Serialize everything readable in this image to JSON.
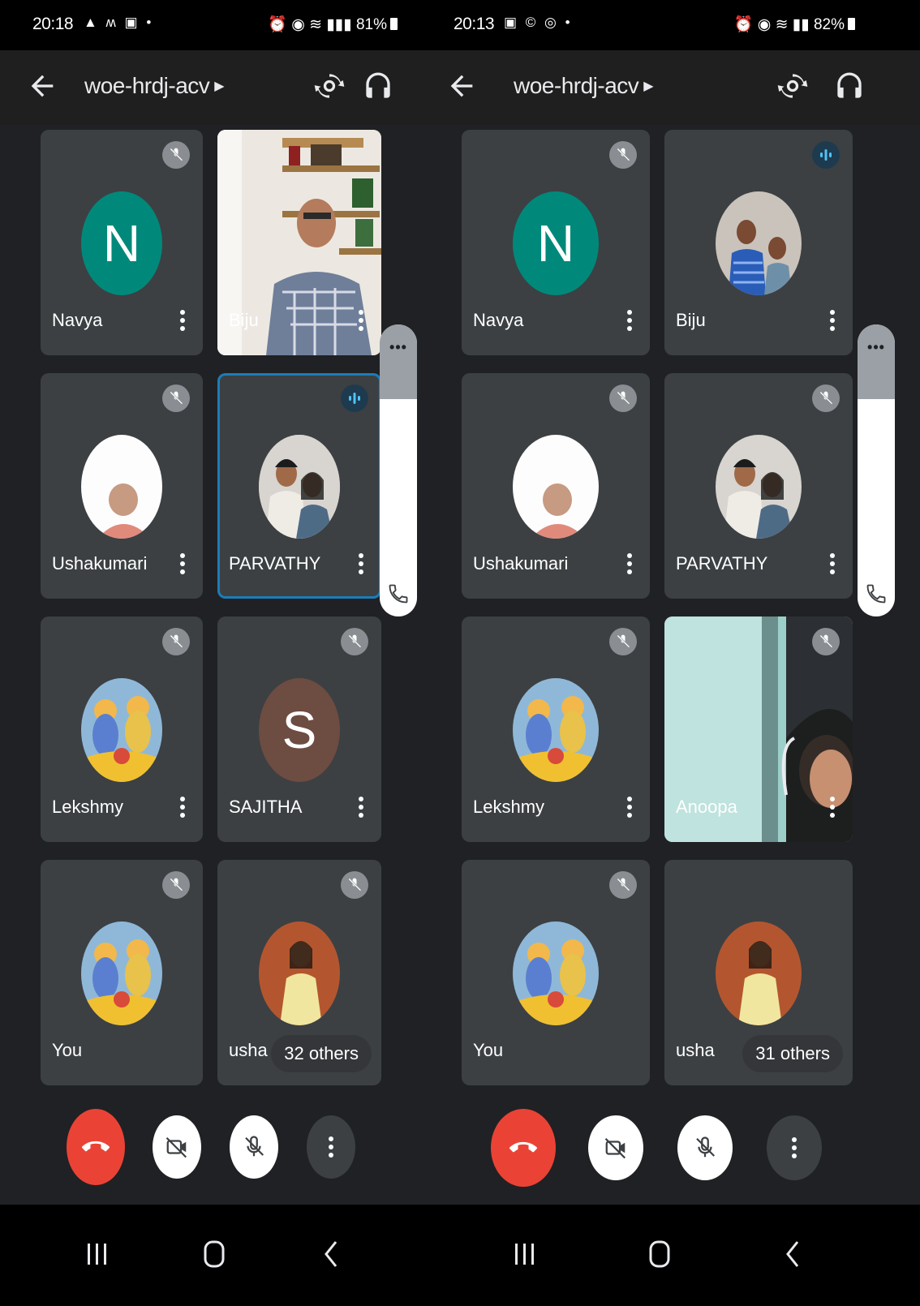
{
  "phones": [
    {
      "id": "left",
      "status": {
        "time": "20:18",
        "left_icons": "▲ ʍ ▣ •",
        "right_text": "81%"
      },
      "meeting_code": "woe-hrdj-acv",
      "tiles": [
        {
          "name": "Navya",
          "kind": "letter",
          "letter": "N",
          "color": "#00897b",
          "muted": true
        },
        {
          "name": "Biju",
          "kind": "video",
          "muted": false
        },
        {
          "name": "Ushakumari",
          "kind": "photo",
          "muted": true
        },
        {
          "name": "PARVATHY",
          "kind": "photo",
          "muted": false,
          "speaking": true
        },
        {
          "name": "Lekshmy",
          "kind": "photo",
          "muted": true
        },
        {
          "name": "SAJITHA",
          "kind": "letter",
          "letter": "S",
          "color": "#6d4c41",
          "muted": true
        },
        {
          "name": "You",
          "kind": "photo",
          "muted": true
        },
        {
          "name": "usha",
          "kind": "photo",
          "muted": true,
          "others": "32 others"
        }
      ]
    },
    {
      "id": "right",
      "status": {
        "time": "20:13",
        "left_icons": "▣ © ◎ •",
        "right_text": "82%"
      },
      "meeting_code": "woe-hrdj-acv",
      "tiles": [
        {
          "name": "Navya",
          "kind": "letter",
          "letter": "N",
          "color": "#00897b",
          "muted": true
        },
        {
          "name": "Biju",
          "kind": "photo",
          "muted": false,
          "speaking": true
        },
        {
          "name": "Ushakumari",
          "kind": "photo",
          "muted": true
        },
        {
          "name": "PARVATHY",
          "kind": "photo",
          "muted": true
        },
        {
          "name": "Lekshmy",
          "kind": "photo",
          "muted": true
        },
        {
          "name": "Anoopa",
          "kind": "video",
          "muted": true
        },
        {
          "name": "You",
          "kind": "photo",
          "muted": true
        },
        {
          "name": "usha",
          "kind": "photo",
          "muted": true,
          "others": "31 others"
        }
      ]
    }
  ],
  "side_panel": {
    "more_label": "•••"
  },
  "colors": {
    "end_call": "#ea4335",
    "tile": "#3c4043",
    "background": "#202124",
    "speaking": "#1a7dba"
  },
  "icons": {
    "back": "arrow-left-icon",
    "switch_camera": "camera-switch-icon",
    "audio": "headphones-icon",
    "mic_off": "mic-off-icon",
    "speaking": "audio-level-icon",
    "more": "more-vert-icon",
    "end_call": "call-end-icon",
    "camera_off": "videocam-off-icon",
    "recent": "recents-icon",
    "home": "home-icon",
    "nav_back": "nav-back-icon",
    "call": "phone-icon"
  }
}
